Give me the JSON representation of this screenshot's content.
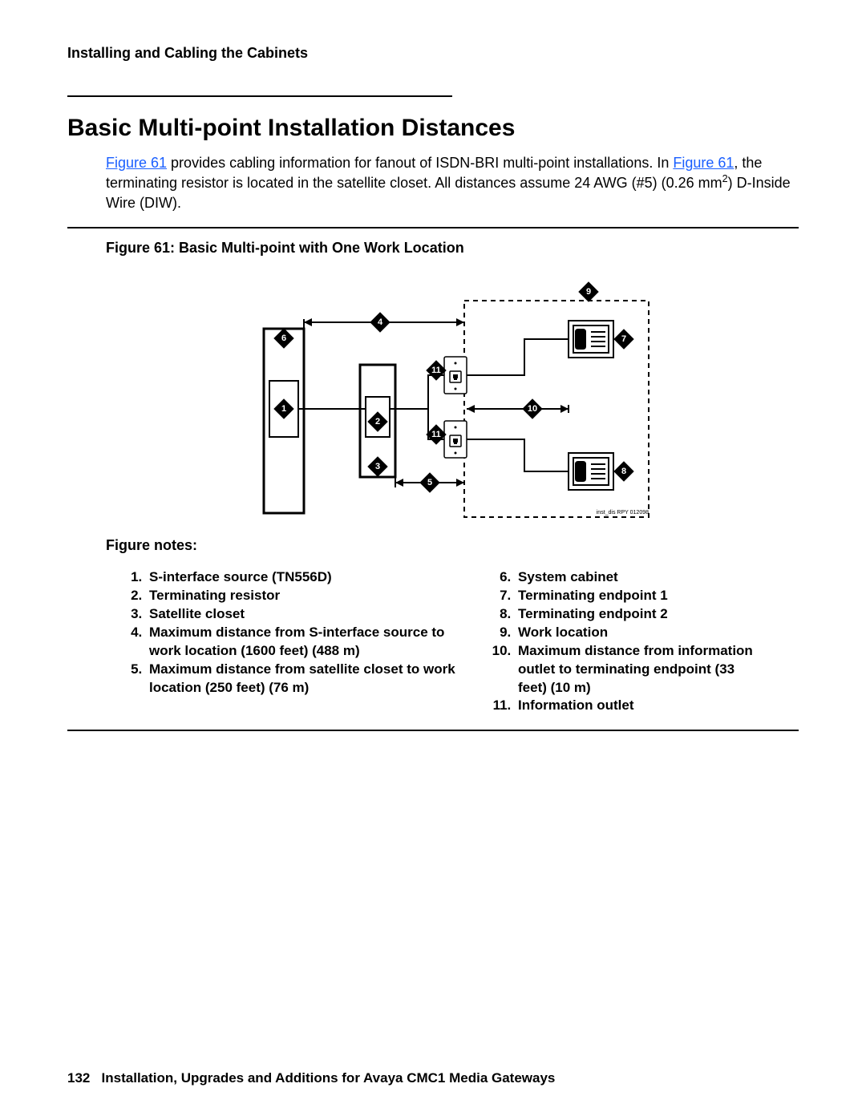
{
  "running_head": "Installing and Cabling the Cabinets",
  "section_title": "Basic Multi-point Installation Distances",
  "para": {
    "link1": "Figure 61",
    "t1": " provides cabling information for fanout of ISDN-BRI multi-point installations. In ",
    "link2": "Figure 61",
    "t2": ", the terminating resistor is located in the satellite closet. All distances assume 24 AWG (#5) (0.26 mm",
    "sup": "2",
    "t3": ") D-Inside Wire (DIW)."
  },
  "figure_caption": "Figure 61: Basic Multi-point with One Work Location",
  "figure_credit": "inst_dis RPY 012098",
  "callouts": [
    "1",
    "2",
    "3",
    "4",
    "5",
    "6",
    "7",
    "8",
    "9",
    "10",
    "11",
    "11"
  ],
  "notes_head": "Figure notes:",
  "notes_left": [
    "S-interface source (TN556D)",
    "Terminating resistor",
    "Satellite closet",
    "Maximum distance from S-interface source to work location (1600 feet) (488 m)",
    "Maximum distance from satellite closet to work location (250 feet) (76 m)"
  ],
  "notes_right": [
    "System cabinet",
    "Terminating endpoint 1",
    "Terminating endpoint 2",
    "Work location",
    "Maximum distance from information outlet to terminating endpoint (33 feet) (10 m)",
    "Information outlet"
  ],
  "footer_page": "132",
  "footer_title": "Installation, Upgrades and Additions for Avaya CMC1 Media Gateways"
}
